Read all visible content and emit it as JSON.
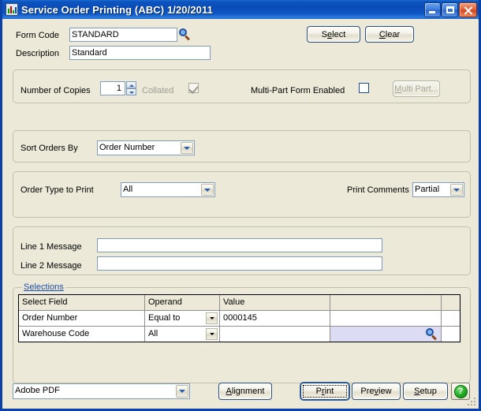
{
  "window": {
    "title": "Service Order Printing (ABC) 1/20/2011",
    "icon": "app-icon",
    "minimize_label": "",
    "maximize_label": "",
    "close_label": ""
  },
  "form": {
    "form_code_label": "Form Code",
    "form_code_value": "STANDARD",
    "form_code_lookup_icon": "magnifier-icon",
    "description_label": "Description",
    "description_value": "Standard",
    "select_button": "Select",
    "clear_button": "Clear"
  },
  "copies": {
    "label": "Number of Copies",
    "value": "1",
    "collated_label": "Collated",
    "collated_checked": true,
    "multipart_label": "Multi-Part Form Enabled",
    "multipart_checked": false,
    "multipart_button": "Multi Part..."
  },
  "sort": {
    "label": "Sort Orders By",
    "value": "Order Number"
  },
  "order_type": {
    "label": "Order Type to Print",
    "value": "All",
    "comments_label": "Print Comments",
    "comments_value": "Partial"
  },
  "messages": {
    "line1_label": "Line 1 Message",
    "line1_value": "",
    "line2_label": "Line 2 Message",
    "line2_value": ""
  },
  "selections": {
    "caption": "Selections",
    "columns": [
      "Select Field",
      "Operand",
      "Value",
      "",
      ""
    ],
    "rows": [
      {
        "field": "Order Number",
        "operand": "Equal to",
        "value": "0000145",
        "value2": "",
        "selected": false,
        "lookup": false
      },
      {
        "field": "Warehouse Code",
        "operand": "All",
        "value": "",
        "value2": "",
        "selected": true,
        "lookup": true,
        "lookup_icon": "magnifier-icon"
      }
    ]
  },
  "footer": {
    "printer_value": "Adobe PDF",
    "alignment_button": "Alignment",
    "print_button": "Print",
    "preview_button": "Preview",
    "setup_button": "Setup",
    "help_button": "?"
  },
  "colors": {
    "title_bar": "#0a4cb8",
    "window_bg": "#ece9d8",
    "link": "#1a4ea8",
    "selected_cell": "#dcdcf5",
    "help_green": "#22aa22"
  }
}
